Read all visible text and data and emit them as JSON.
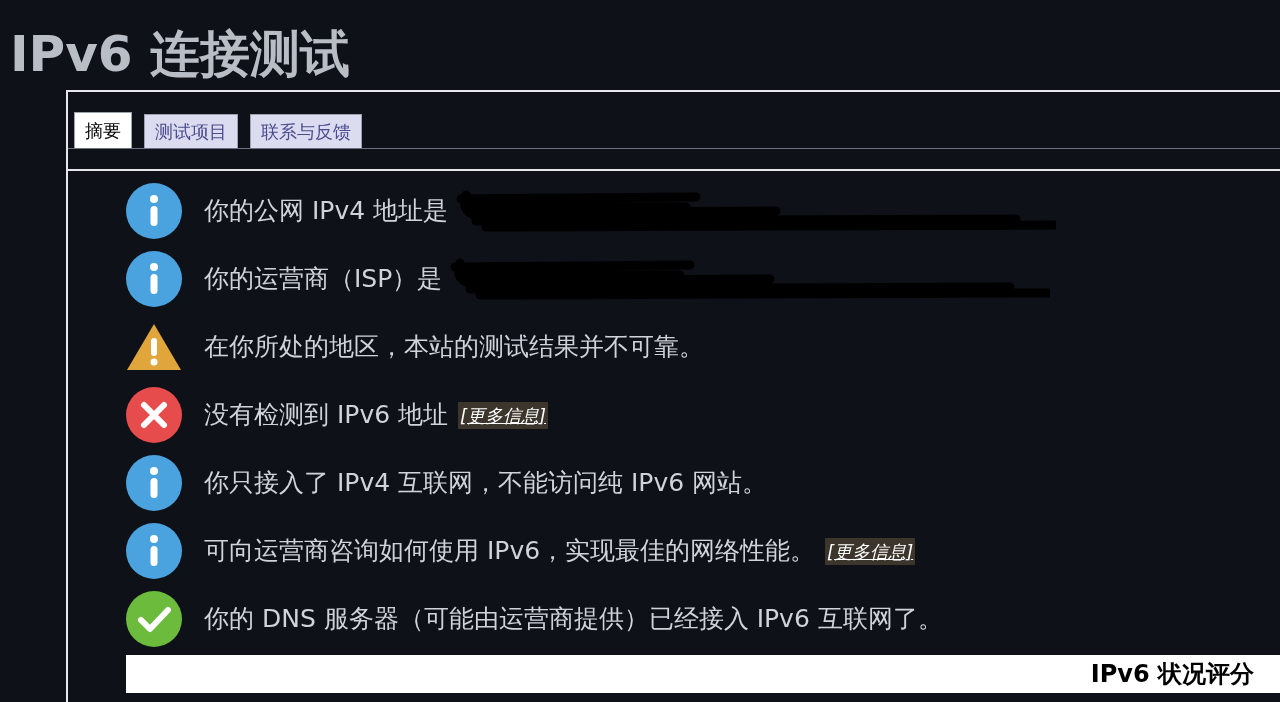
{
  "title": "IPv6 连接测试",
  "tabs": [
    {
      "label": "摘要",
      "selected": true
    },
    {
      "label": "测试项目",
      "selected": false
    },
    {
      "label": "联系与反馈",
      "selected": false
    }
  ],
  "results": [
    {
      "kind": "info",
      "text": "你的公网 IPv4 地址是",
      "redacted": true
    },
    {
      "kind": "info",
      "text": "你的运营商（ISP）是",
      "redacted": true
    },
    {
      "kind": "warning",
      "text": "在你所处的地区，本站的测试结果并不可靠。"
    },
    {
      "kind": "error",
      "text": "没有检测到 IPv6 地址",
      "link": "[更多信息]"
    },
    {
      "kind": "info",
      "text": "你只接入了 IPv4 互联网，不能访问纯 IPv6 网站。"
    },
    {
      "kind": "info",
      "text": "可向运营商咨询如何使用 IPv6，实现最佳的网络性能。",
      "link": "[更多信息]"
    },
    {
      "kind": "ok",
      "text": "你的 DNS 服务器（可能由运营商提供）已经接入 IPv6 互联网了。"
    }
  ],
  "score_header": "IPv6 状况评分"
}
